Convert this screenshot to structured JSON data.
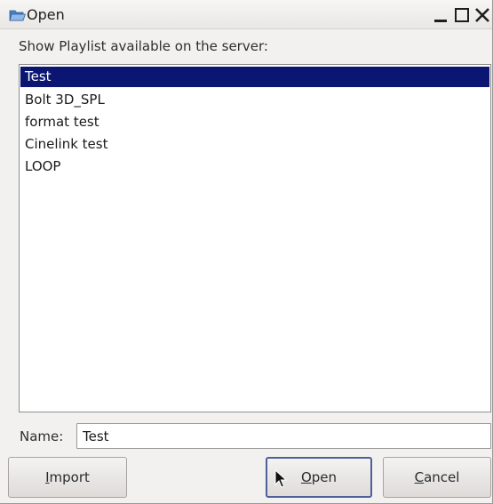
{
  "window": {
    "title": "Open",
    "icons": {
      "app": "open-folder-icon",
      "minimize": "minimize-icon",
      "maximize": "maximize-icon",
      "close": "close-icon"
    }
  },
  "dialog": {
    "prompt": "Show Playlist available on the server:",
    "playlists": [
      {
        "label": "Test",
        "selected": true
      },
      {
        "label": "Bolt 3D_SPL",
        "selected": false
      },
      {
        "label": "format test",
        "selected": false
      },
      {
        "label": "Cinelink test",
        "selected": false
      },
      {
        "label": "LOOP",
        "selected": false
      }
    ],
    "name_label": "Name:",
    "name_value": "Test"
  },
  "buttons": {
    "import_label": "Import",
    "import_mnemonic": "I",
    "open_label": "Open",
    "open_mnemonic": "O",
    "cancel_label": "Cancel",
    "cancel_mnemonic": "C"
  },
  "colors": {
    "selection": "#0a1672",
    "window_bg": "#f2f1f0",
    "default_button_border": "#4f5f98"
  }
}
